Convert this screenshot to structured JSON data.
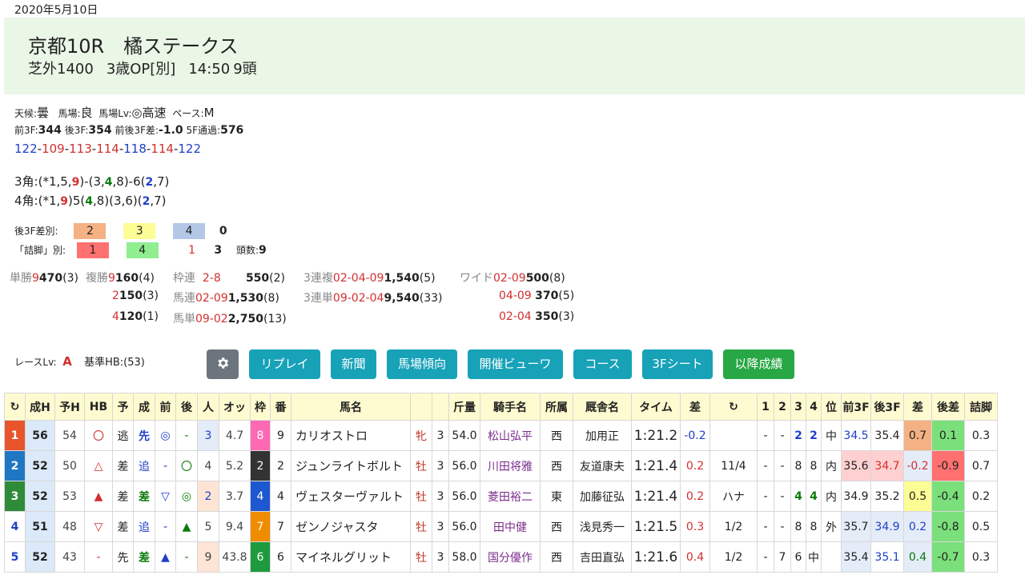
{
  "date": "2020年5月10日",
  "race": {
    "title": "京都10R",
    "name": "橘ステークス",
    "course": "芝外1400",
    "cls": "3歳OP[別]",
    "time": "14:50",
    "count": "9頭"
  },
  "cond": {
    "weather_l": "天候:",
    "weather": "曇",
    "ground_l": "馬場:",
    "ground": "良",
    "lv_l": "馬場Lv:",
    "lv": "◎高速",
    "pace_l": "ペース:",
    "pace": "M"
  },
  "f3": {
    "l1": "前3F:",
    "v1": "344",
    "l2": "後3F:",
    "v2": "354",
    "l3": "前後3F差:",
    "v3": "-1.0",
    "l4": "5F通過:",
    "v4": "576"
  },
  "laps": [
    "122",
    "109",
    "113",
    "114",
    "118",
    "114",
    "122"
  ],
  "corners": {
    "c3": [
      "3角:(*1,5,",
      "9",
      ")-(3,",
      "4",
      ",8)-6(",
      "2",
      ",7)"
    ],
    "c4": [
      "4角:(*1,",
      "9",
      ")5(",
      "4",
      ",8)(3,6)(",
      "2",
      ",7)"
    ]
  },
  "diff3f": {
    "label": "後3F差別:",
    "v": [
      "2",
      "3",
      "4",
      "0"
    ]
  },
  "tsume": {
    "label": "「詰脚」別:",
    "v": [
      "1",
      "4",
      "1",
      "3"
    ],
    "count_l": "頭数:",
    "count": "9"
  },
  "payouts": {
    "tansho": [
      "単勝",
      "9",
      "470",
      "(3)"
    ],
    "fukusho_l": "複勝",
    "fukusho": [
      [
        "9",
        "160",
        "(4)"
      ],
      [
        "2",
        "150",
        "(3)"
      ],
      [
        "4",
        "120",
        "(1)"
      ]
    ],
    "wakuren": [
      "枠連",
      "2-8",
      "550",
      "(2)"
    ],
    "umaren": [
      "馬連",
      "02-09",
      "1,530",
      "(8)"
    ],
    "umatan": [
      "馬単",
      "09-02",
      "2,750",
      "(13)"
    ],
    "sanfuku": [
      "3連複",
      "02-04-09",
      "1,540",
      "(5)"
    ],
    "santan": [
      "3連単",
      "09-02-04",
      "9,540",
      "(33)"
    ],
    "wide_l": "ワイド",
    "wide": [
      [
        "02-09",
        "500",
        "(8)"
      ],
      [
        "04-09",
        "370",
        "(5)"
      ],
      [
        "02-04",
        "350",
        "(3)"
      ]
    ]
  },
  "racelv": {
    "label": "レースLv:",
    "value": "A",
    "base": "基準HB:(53)"
  },
  "buttons": [
    "リプレイ",
    "新聞",
    "馬場傾向",
    "開催ビューワ",
    "コース",
    "3Fシート",
    "以降成績"
  ],
  "colors": {
    "teal": "#17a2b8",
    "green": "#28a745",
    "gear": "#6c757d"
  },
  "columns": [
    "成H",
    "予H",
    "HB",
    "予",
    "成",
    "前",
    "後",
    "人",
    "オッ",
    "枠",
    "番",
    "馬名",
    "",
    "",
    "斤量",
    "騎手名",
    "所属",
    "厩舎名",
    "タイム",
    "差",
    "",
    "1",
    "2",
    "3",
    "4",
    "位",
    "前3F",
    "後3F",
    "差",
    "後差",
    "詰脚"
  ],
  "rows": [
    [
      "1",
      "56",
      "54",
      "〇",
      "逃",
      "先",
      "◎",
      "-",
      "3",
      "4.7",
      "8",
      "9",
      "カリオストロ",
      "牝",
      "3",
      "54.0",
      "松山弘平",
      "西",
      "加用正",
      "1:21.2",
      "-0.2",
      "",
      "-",
      "-",
      "2",
      "2",
      "中",
      "34.5",
      "35.4",
      "0.7",
      "0.1",
      "0.3"
    ],
    [
      "2",
      "52",
      "50",
      "△",
      "差",
      "追",
      "-",
      "〇",
      "4",
      "5.2",
      "2",
      "2",
      "ジュンライトボルト",
      "牡",
      "3",
      "56.0",
      "川田将雅",
      "西",
      "友道康夫",
      "1:21.4",
      "0.2",
      "11/4",
      "-",
      "-",
      "8",
      "8",
      "内",
      "35.6",
      "34.7",
      "-0.2",
      "-0.9",
      "0.7"
    ],
    [
      "3",
      "52",
      "53",
      "▲",
      "差",
      "差",
      "▽",
      "◎",
      "2",
      "3.7",
      "4",
      "4",
      "ヴェスターヴァルト",
      "牡",
      "3",
      "56.0",
      "菱田裕二",
      "東",
      "加藤征弘",
      "1:21.4",
      "0.2",
      "ハナ",
      "-",
      "-",
      "4",
      "4",
      "内",
      "34.9",
      "35.2",
      "0.5",
      "-0.4",
      "0.2"
    ],
    [
      "4",
      "51",
      "48",
      "▽",
      "差",
      "追",
      "-",
      "▲",
      "5",
      "9.4",
      "7",
      "7",
      "ゼンノジャスタ",
      "牡",
      "3",
      "56.0",
      "田中健",
      "西",
      "浅見秀一",
      "1:21.5",
      "0.3",
      "1/2",
      "-",
      "-",
      "8",
      "8",
      "外",
      "35.7",
      "34.9",
      "0.2",
      "-0.8",
      "0.5"
    ],
    [
      "5",
      "52",
      "43",
      "-",
      "先",
      "差",
      "▲",
      "-",
      "9",
      "43.8",
      "6",
      "6",
      "マイネルグリット",
      "牡",
      "3",
      "58.0",
      "国分優作",
      "西",
      "吉田直弘",
      "1:21.6",
      "0.4",
      "1/2",
      "-",
      "7",
      "6",
      "中",
      "",
      "35.4",
      "35.1",
      "0.4",
      "-0.7",
      "0.3"
    ]
  ]
}
